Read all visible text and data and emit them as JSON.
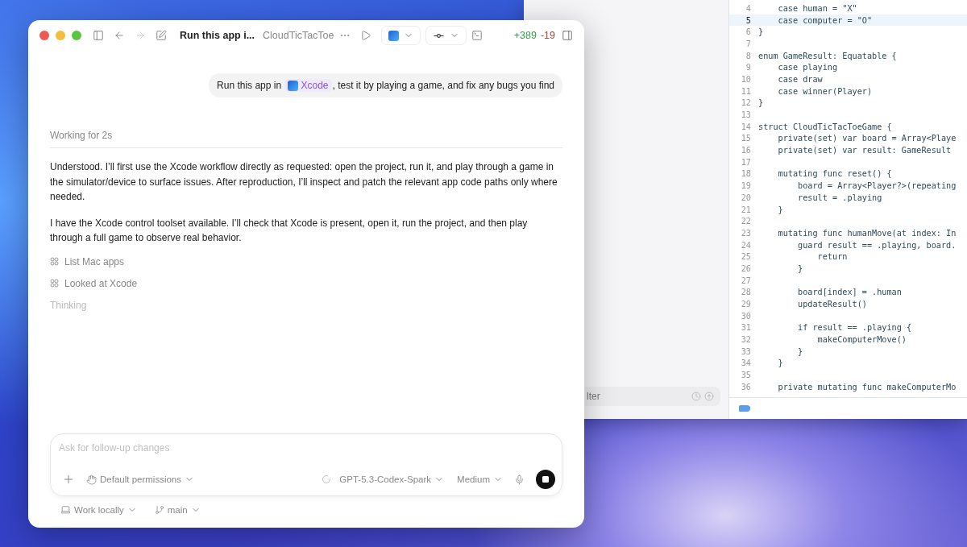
{
  "chat_window": {
    "toolbar": {
      "title": "Run this app i...",
      "project": "CloudTicTacToe",
      "back_disabled": false,
      "forward_disabled": true,
      "diff_added": "+389",
      "diff_removed": "-19"
    },
    "user_message": [
      {
        "kind": "text",
        "text": "Run this app in "
      },
      {
        "kind": "mention",
        "text": "Xcode"
      },
      {
        "kind": "text",
        "text": ", test it by playing a game, and fix any bugs you find"
      }
    ],
    "status": "Working for 2s",
    "paragraphs": [
      "Understood. I’ll first use the Xcode workflow directly as requested: open the project, run it, and play through a game in the simulator/device to surface issues. After reproduction, I’ll inspect and patch the relevant app code paths only where needed.",
      "I have the Xcode control toolset available. I’ll check that Xcode is present, open it, run the project, and then play through a full game to observe real behavior."
    ],
    "steps": [
      "List Mac apps",
      "Looked at Xcode"
    ],
    "thinking": "Thinking",
    "composer": {
      "placeholder": "Ask for follow-up changes",
      "permissions": "Default permissions",
      "model": "GPT-5.3-Codex-Spark",
      "effort": "Medium"
    },
    "footer": {
      "location": "Work locally",
      "branch": "main"
    }
  },
  "xcode_window": {
    "filter": "lter",
    "lines": [
      {
        "number": "4",
        "text": "    case human = \"X\"",
        "current": false
      },
      {
        "number": "5",
        "text": "    case computer = \"O\"",
        "current": true
      },
      {
        "number": "6",
        "text": "}",
        "current": false
      },
      {
        "number": "7",
        "current": false
      },
      {
        "number": "8",
        "text": "enum GameResult: Equatable {",
        "current": false
      },
      {
        "number": "9",
        "text": "    case playing",
        "current": false
      },
      {
        "number": "10",
        "text": "    case draw",
        "current": false
      },
      {
        "number": "11",
        "text": "    case winner(Player)",
        "current": false
      },
      {
        "number": "12",
        "text": "}",
        "current": false
      },
      {
        "number": "13",
        "current": false
      },
      {
        "number": "14",
        "text": "struct CloudTicTacToeGame {",
        "current": false
      },
      {
        "number": "15",
        "text": "    private(set) var board = Array<Playe",
        "current": false
      },
      {
        "number": "16",
        "text": "    private(set) var result: GameResult",
        "current": false
      },
      {
        "number": "17",
        "current": false
      },
      {
        "number": "18",
        "text": "    mutating func reset() {",
        "current": false
      },
      {
        "number": "19",
        "text": "        board = Array<Player?>(repeating",
        "current": false
      },
      {
        "number": "20",
        "text": "        result = .playing",
        "current": false
      },
      {
        "number": "21",
        "text": "    }",
        "current": false
      },
      {
        "number": "22",
        "current": false
      },
      {
        "number": "23",
        "text": "    mutating func humanMove(at index: In",
        "current": false
      },
      {
        "number": "24",
        "text": "        guard result == .playing, board.",
        "current": false
      },
      {
        "number": "25",
        "text": "            return",
        "current": false
      },
      {
        "number": "26",
        "text": "        }",
        "current": false
      },
      {
        "number": "27",
        "current": false
      },
      {
        "number": "28",
        "text": "        board[index] = .human",
        "current": false
      },
      {
        "number": "29",
        "text": "        updateResult()",
        "current": false
      },
      {
        "number": "30",
        "current": false
      },
      {
        "number": "31",
        "text": "        if result == .playing {",
        "current": false
      },
      {
        "number": "32",
        "text": "            makeComputerMove()",
        "current": false
      },
      {
        "number": "33",
        "text": "        }",
        "current": false
      },
      {
        "number": "34",
        "text": "    }",
        "current": false
      },
      {
        "number": "35",
        "current": false
      },
      {
        "number": "36",
        "text": "    private mutating func makeComputerMo",
        "current": false
      }
    ]
  }
}
